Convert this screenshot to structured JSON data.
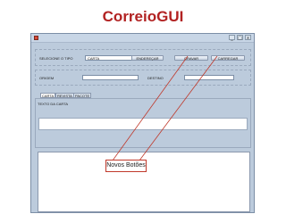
{
  "slide": {
    "title": "CorreioGUI"
  },
  "window": {
    "controls": [
      "_",
      "□",
      "x"
    ]
  },
  "form": {
    "tipo_label": "SELECIONE O TIPO",
    "tipo_value": "CARTA",
    "btn_enderecar": "ENDEREÇAR",
    "btn_gravar": "GRAVAR",
    "btn_carregar": "CARREGAR",
    "origem_label": "ORIGEM",
    "destino_label": "DESTINO",
    "origem_value": "",
    "destino_value": ""
  },
  "tabs": [
    "CARTA",
    "REVISTA",
    "PACOTE"
  ],
  "tab_content": {
    "texto_label": "TEXTO DA CARTA"
  },
  "callout": {
    "label": "Novos Botões",
    "color": "#c0392b"
  },
  "colors": {
    "title": "#b22222",
    "window_bg": "#bccbdc"
  }
}
